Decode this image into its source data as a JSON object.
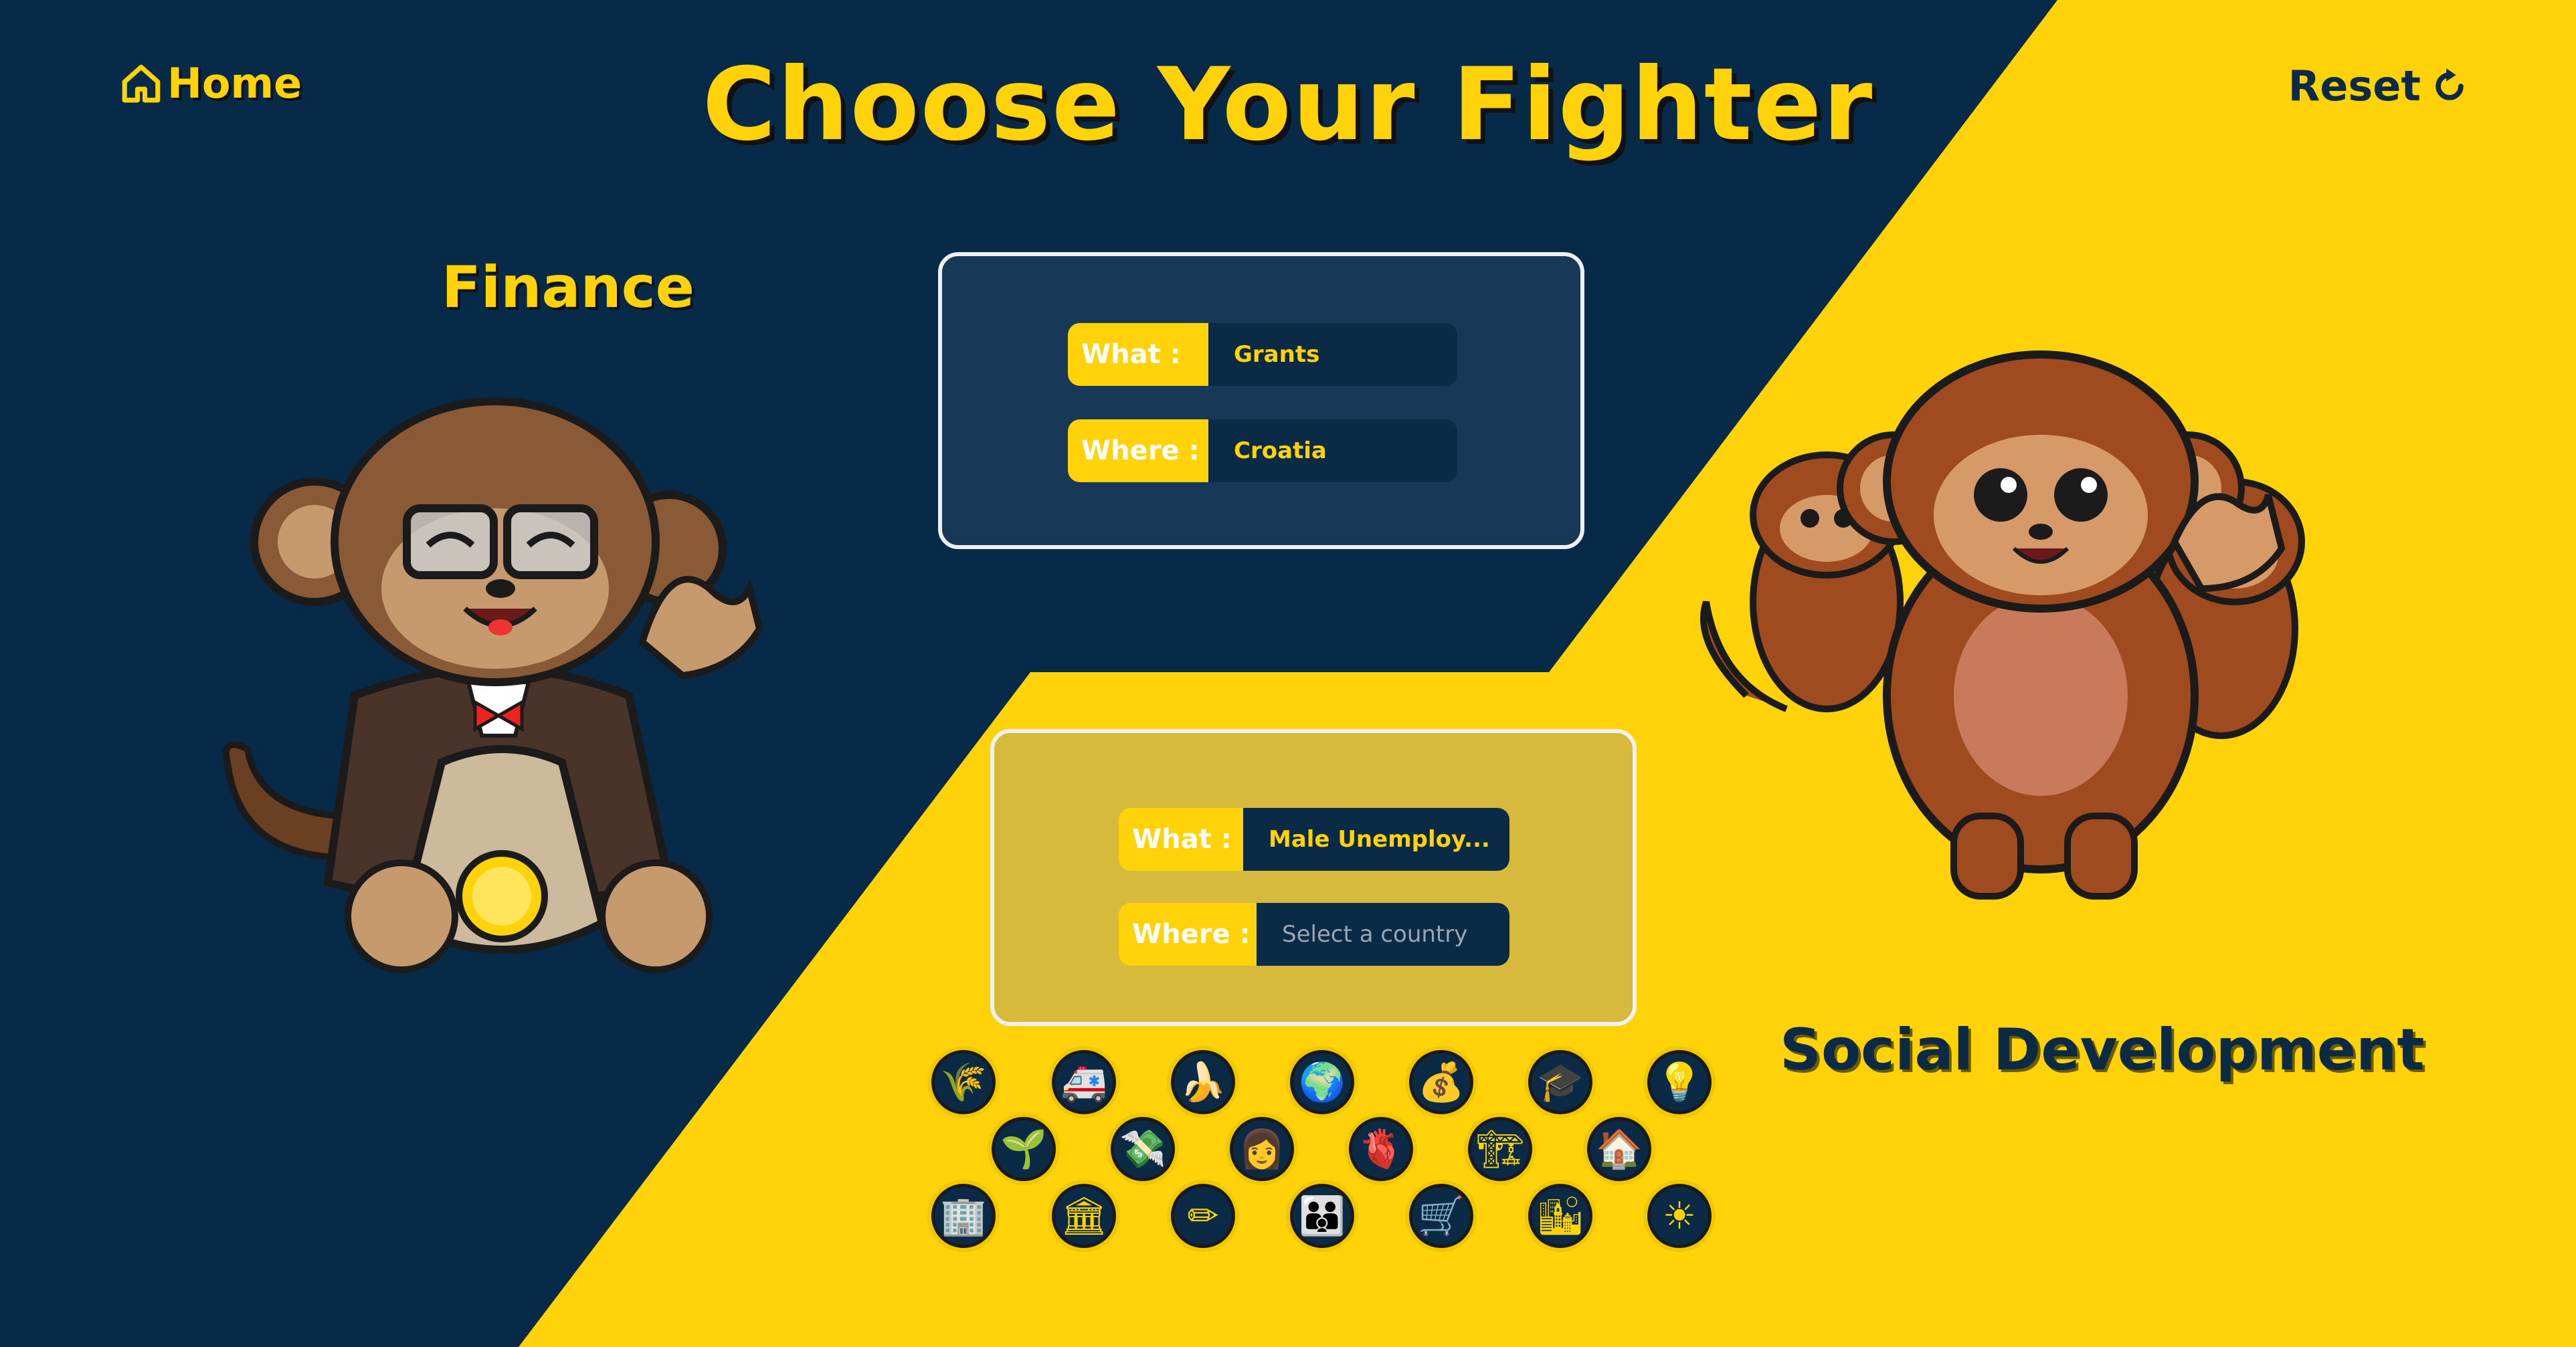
{
  "header": {
    "title": "Choose Your Fighter",
    "home_label": "Home",
    "reset_label": "Reset"
  },
  "fighters": {
    "left_label": "Finance",
    "right_label": "Social Development"
  },
  "finance_panel": {
    "what_label": "What :",
    "what_value": "Grants",
    "where_label": "Where :",
    "where_value": "Croatia"
  },
  "social_panel": {
    "what_label": "What :",
    "what_value": "Male Unemploy...",
    "where_label": "Where :",
    "where_placeholder": "Select a country"
  },
  "colors": {
    "navy": "#062a47",
    "yellow": "#ffd20a"
  },
  "indicator_icons": [
    {
      "name": "wheat-icon",
      "glyph": "🌾"
    },
    {
      "name": "ambulance-icon",
      "glyph": "🚑"
    },
    {
      "name": "banana-icon",
      "glyph": "🍌"
    },
    {
      "name": "globe-icon",
      "glyph": "🌍"
    },
    {
      "name": "money-bag-icon",
      "glyph": "💰"
    },
    {
      "name": "graduation-cap-icon",
      "glyph": "🎓"
    },
    {
      "name": "light-bulb-icon",
      "glyph": "💡"
    },
    {
      "name": "seedling-icon",
      "glyph": "🌱"
    },
    {
      "name": "money-with-wings-icon",
      "glyph": "💸"
    },
    {
      "name": "woman-icon",
      "glyph": "👩"
    },
    {
      "name": "anatomical-heart-icon",
      "glyph": "🫀"
    },
    {
      "name": "construction-crane-icon",
      "glyph": "🏗"
    },
    {
      "name": "house-icon",
      "glyph": "🏠"
    },
    {
      "name": "office-building-icon",
      "glyph": "🏢"
    },
    {
      "name": "classical-building-icon",
      "glyph": "🏛"
    },
    {
      "name": "pencil-icon",
      "glyph": "✏"
    },
    {
      "name": "family-icon",
      "glyph": "👪"
    },
    {
      "name": "shopping-cart-icon",
      "glyph": "🛒"
    },
    {
      "name": "cityscape-icon",
      "glyph": "🏙"
    },
    {
      "name": "sun-icon",
      "glyph": "☀"
    }
  ]
}
